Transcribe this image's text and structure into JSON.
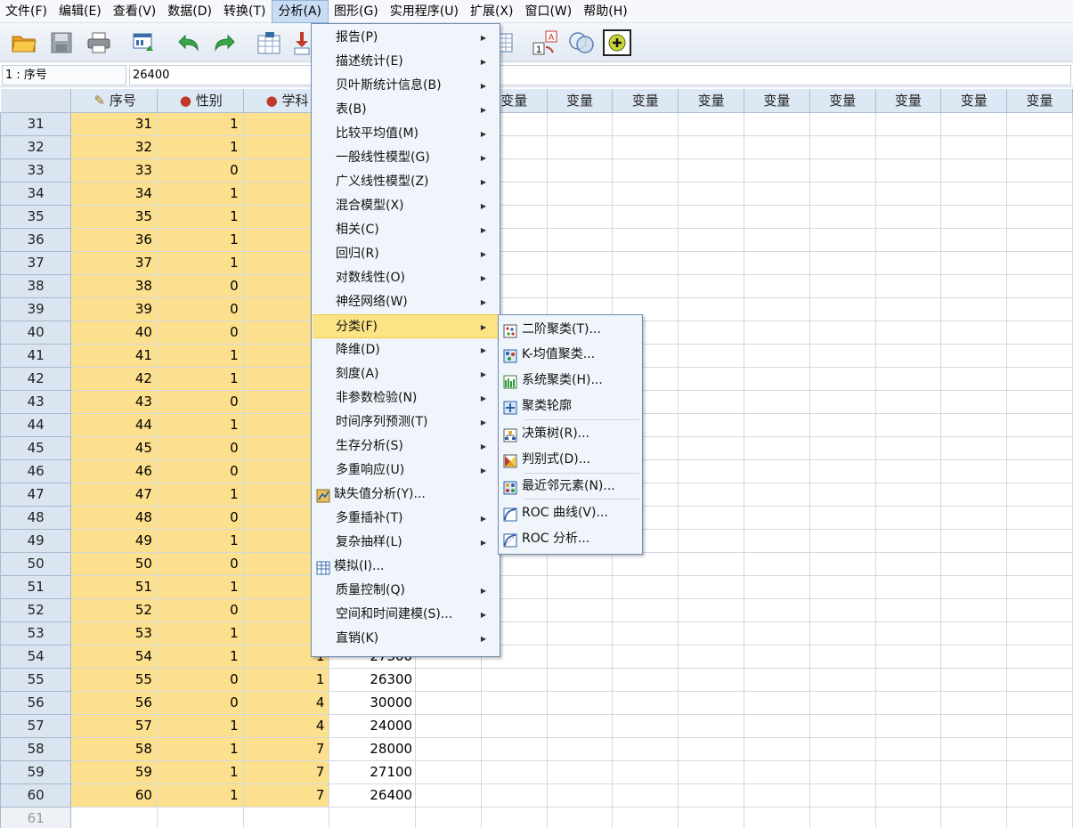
{
  "menubar": [
    "文件(F)",
    "编辑(E)",
    "查看(V)",
    "数据(D)",
    "转换(T)",
    "分析(A)",
    "图形(G)",
    "实用程序(U)",
    "扩展(X)",
    "窗口(W)",
    "帮助(H)"
  ],
  "toolbar": {
    "icons": [
      "open-icon",
      "save-icon",
      "print-icon",
      "dialog-recall-icon",
      "undo-icon",
      "redo-icon",
      "goto-case-icon",
      "goto-variable-icon",
      "variables-icon",
      "value-labels-icon",
      "use-sets-icon",
      "spelling-icon"
    ]
  },
  "cell_editor": {
    "address": "1 : 序号",
    "value": "26400"
  },
  "grid": {
    "columns": [
      "序号",
      "性别",
      "学科",
      "",
      "变量",
      "变量",
      "变量",
      "变量",
      "变量",
      "变量",
      "变量",
      "变量",
      "变量"
    ],
    "rows": [
      {
        "n": "31",
        "seq": "31",
        "sex": "1",
        "subj": "",
        "val": ""
      },
      {
        "n": "32",
        "seq": "32",
        "sex": "1",
        "subj": "",
        "val": ""
      },
      {
        "n": "33",
        "seq": "33",
        "sex": "0",
        "subj": "",
        "val": ""
      },
      {
        "n": "34",
        "seq": "34",
        "sex": "1",
        "subj": "",
        "val": ""
      },
      {
        "n": "35",
        "seq": "35",
        "sex": "1",
        "subj": "",
        "val": ""
      },
      {
        "n": "36",
        "seq": "36",
        "sex": "1",
        "subj": "",
        "val": ""
      },
      {
        "n": "37",
        "seq": "37",
        "sex": "1",
        "subj": "",
        "val": ""
      },
      {
        "n": "38",
        "seq": "38",
        "sex": "0",
        "subj": "",
        "val": ""
      },
      {
        "n": "39",
        "seq": "39",
        "sex": "0",
        "subj": "",
        "val": ""
      },
      {
        "n": "40",
        "seq": "40",
        "sex": "0",
        "subj": "",
        "val": ""
      },
      {
        "n": "41",
        "seq": "41",
        "sex": "1",
        "subj": "",
        "val": ""
      },
      {
        "n": "42",
        "seq": "42",
        "sex": "1",
        "subj": "",
        "val": ""
      },
      {
        "n": "43",
        "seq": "43",
        "sex": "0",
        "subj": "",
        "val": ""
      },
      {
        "n": "44",
        "seq": "44",
        "sex": "1",
        "subj": "",
        "val": ""
      },
      {
        "n": "45",
        "seq": "45",
        "sex": "0",
        "subj": "",
        "val": ""
      },
      {
        "n": "46",
        "seq": "46",
        "sex": "0",
        "subj": "",
        "val": ""
      },
      {
        "n": "47",
        "seq": "47",
        "sex": "1",
        "subj": "",
        "val": ""
      },
      {
        "n": "48",
        "seq": "48",
        "sex": "0",
        "subj": "",
        "val": ""
      },
      {
        "n": "49",
        "seq": "49",
        "sex": "1",
        "subj": "",
        "val": ""
      },
      {
        "n": "50",
        "seq": "50",
        "sex": "0",
        "subj": "",
        "val": ""
      },
      {
        "n": "51",
        "seq": "51",
        "sex": "1",
        "subj": "",
        "val": ""
      },
      {
        "n": "52",
        "seq": "52",
        "sex": "0",
        "subj": "",
        "val": ""
      },
      {
        "n": "53",
        "seq": "53",
        "sex": "1",
        "subj": "",
        "val": ""
      },
      {
        "n": "54",
        "seq": "54",
        "sex": "1",
        "subj": "1",
        "val": "27300"
      },
      {
        "n": "55",
        "seq": "55",
        "sex": "0",
        "subj": "1",
        "val": "26300"
      },
      {
        "n": "56",
        "seq": "56",
        "sex": "0",
        "subj": "4",
        "val": "30000"
      },
      {
        "n": "57",
        "seq": "57",
        "sex": "1",
        "subj": "4",
        "val": "24000"
      },
      {
        "n": "58",
        "seq": "58",
        "sex": "1",
        "subj": "7",
        "val": "28000"
      },
      {
        "n": "59",
        "seq": "59",
        "sex": "1",
        "subj": "7",
        "val": "27100"
      },
      {
        "n": "60",
        "seq": "60",
        "sex": "1",
        "subj": "7",
        "val": "26400"
      },
      {
        "n": "61",
        "seq": "",
        "sex": "",
        "subj": "",
        "val": "",
        "empty": true
      }
    ]
  },
  "analyze_menu": [
    {
      "label": "报告(P)",
      "submenu": true
    },
    {
      "label": "描述统计(E)",
      "submenu": true
    },
    {
      "label": "贝叶斯统计信息(B)",
      "submenu": true
    },
    {
      "label": "表(B)",
      "submenu": true
    },
    {
      "label": "比较平均值(M)",
      "submenu": true
    },
    {
      "label": "一般线性模型(G)",
      "submenu": true
    },
    {
      "label": "广义线性模型(Z)",
      "submenu": true
    },
    {
      "label": "混合模型(X)",
      "submenu": true
    },
    {
      "label": "相关(C)",
      "submenu": true
    },
    {
      "label": "回归(R)",
      "submenu": true
    },
    {
      "label": "对数线性(O)",
      "submenu": true
    },
    {
      "label": "神经网络(W)",
      "submenu": true
    },
    {
      "label": "分类(F)",
      "submenu": true,
      "highlighted": true
    },
    {
      "label": "降维(D)",
      "submenu": true
    },
    {
      "label": "刻度(A)",
      "submenu": true
    },
    {
      "label": "非参数检验(N)",
      "submenu": true
    },
    {
      "label": "时间序列预测(T)",
      "submenu": true
    },
    {
      "label": "生存分析(S)",
      "submenu": true
    },
    {
      "label": "多重响应(U)",
      "submenu": true
    },
    {
      "label": "缺失值分析(Y)...",
      "submenu": false,
      "icon": "missing-values-icon"
    },
    {
      "label": "多重插补(T)",
      "submenu": true
    },
    {
      "label": "复杂抽样(L)",
      "submenu": true
    },
    {
      "label": "模拟(I)...",
      "submenu": false,
      "icon": "simulation-icon"
    },
    {
      "label": "质量控制(Q)",
      "submenu": true
    },
    {
      "label": "空间和时间建模(S)...",
      "submenu": true
    },
    {
      "label": "直销(K)",
      "submenu": true
    }
  ],
  "classify_submenu": [
    {
      "label": "二阶聚类(T)...",
      "icon": "twostep-cluster-icon"
    },
    {
      "label": "K-均值聚类...",
      "icon": "kmeans-cluster-icon"
    },
    {
      "label": "系统聚类(H)...",
      "icon": "hierarchical-cluster-icon"
    },
    {
      "label": "聚类轮廓",
      "icon": "cluster-silhouettes-icon"
    },
    {
      "label": "决策树(R)...",
      "icon": "decision-tree-icon"
    },
    {
      "label": "判别式(D)...",
      "icon": "discriminant-icon"
    },
    {
      "label": "最近邻元素(N)...",
      "icon": "nearest-neighbor-icon"
    },
    {
      "label": "ROC 曲线(V)...",
      "icon": "roc-curve-icon"
    },
    {
      "label": "ROC 分析...",
      "icon": "roc-analysis-icon"
    }
  ],
  "colors": {
    "data_cell": "#fde08e",
    "highlight": "#fce384",
    "menu_bg": "#f0f5fb",
    "header_bg": "#dde8f5"
  }
}
